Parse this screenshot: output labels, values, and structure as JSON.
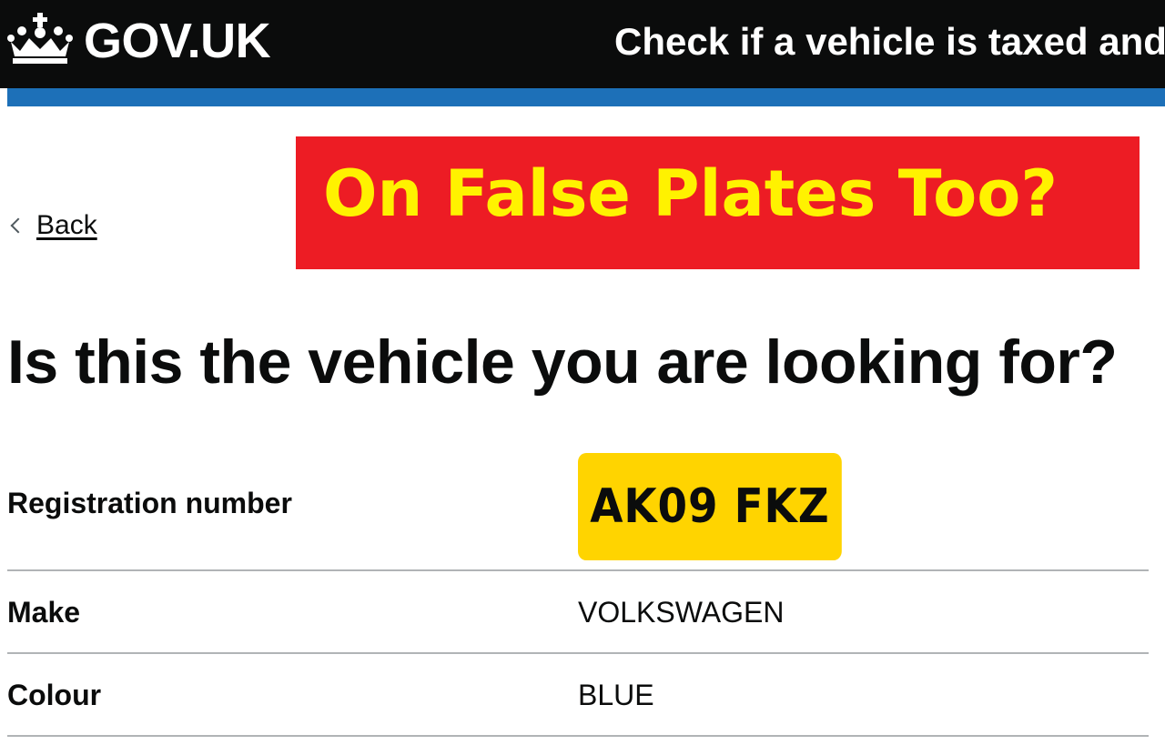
{
  "header": {
    "logo_text": "GOV.UK",
    "service_name": "Check if a vehicle is taxed and has an MOT"
  },
  "navigation": {
    "back_label": "Back"
  },
  "banner": {
    "text": "On False Plates Too?",
    "background_color": "#ed1c24",
    "text_color": "#fff200"
  },
  "main": {
    "title": "Is this the vehicle you are looking for?",
    "rows": [
      {
        "key": "Registration number",
        "value": "AK09 FKZ"
      },
      {
        "key": "Make",
        "value": "VOLKSWAGEN"
      },
      {
        "key": "Colour",
        "value": "BLUE"
      }
    ]
  },
  "colors": {
    "header_bg": "#0b0c0c",
    "accent_blue": "#1d70b8",
    "plate_yellow": "#ffd400",
    "divider": "#b1b4b6"
  },
  "icons": {
    "logo": "crown-icon",
    "back": "chevron-left-icon"
  }
}
